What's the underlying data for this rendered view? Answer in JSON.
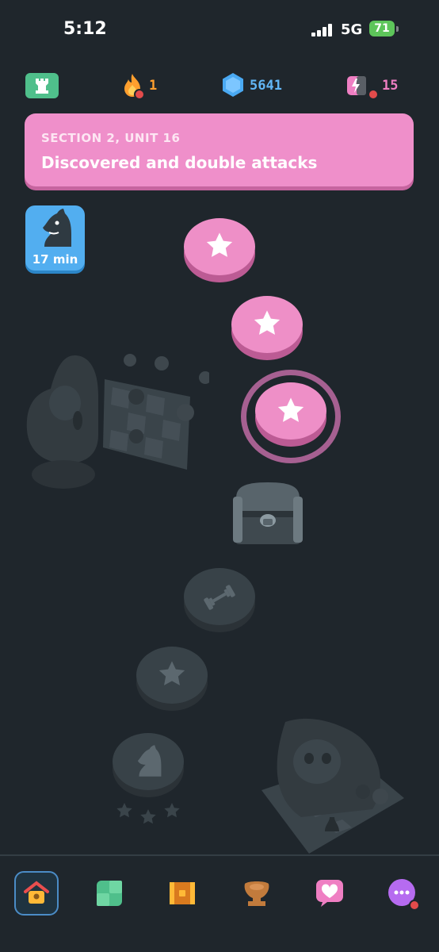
{
  "status_bar": {
    "time": "5:12",
    "network": "5G",
    "battery": "71"
  },
  "stats": {
    "streak": "1",
    "gems": "5641",
    "hearts": "15"
  },
  "section": {
    "subtitle": "SECTION 2, UNIT 16",
    "title": "Discovered and double attacks"
  },
  "lesson_badge": {
    "duration": "17 min"
  },
  "colors": {
    "background": "#1f262c",
    "section_pink": "#ef8fca",
    "node_pink": "#ee8fc7",
    "node_locked": "#384248",
    "streak_orange": "#ff9f2e",
    "gem_blue": "#4aa9f2",
    "heart_pink": "#ef7fc3"
  },
  "nav": {
    "items": [
      {
        "icon": "home-icon",
        "active": true
      },
      {
        "icon": "puzzle-icon",
        "active": false
      },
      {
        "icon": "chest-icon",
        "active": false
      },
      {
        "icon": "trophy-icon",
        "active": false
      },
      {
        "icon": "heart-icon",
        "active": false
      },
      {
        "icon": "more-icon",
        "active": false
      }
    ]
  }
}
